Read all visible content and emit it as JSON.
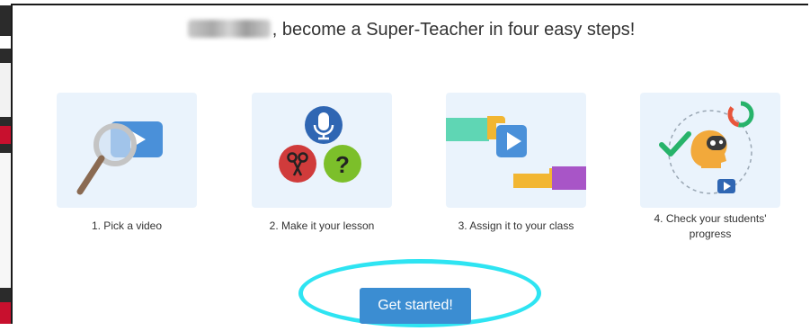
{
  "modal": {
    "title_suffix": ", become a Super-Teacher in four easy steps!"
  },
  "steps": [
    {
      "label": "1. Pick a video",
      "icon": "magnifier-video-icon"
    },
    {
      "label": "2. Make it your lesson",
      "icon": "lesson-tools-icon"
    },
    {
      "label": "3. Assign it to your class",
      "icon": "assign-video-icon"
    },
    {
      "label": "4. Check your students' progress",
      "icon": "student-progress-icon"
    }
  ],
  "cta": {
    "label": "Get started!"
  },
  "colors": {
    "tile_bg": "#eaf3fc",
    "video_blue": "#4a90d9",
    "button_blue": "#3b8dd2",
    "highlight_cyan": "#2ee4f2",
    "check_green": "#27b36a",
    "mic_blue": "#2f66b3",
    "scissors_red": "#d03b3b",
    "question_green": "#7cbf2a"
  }
}
